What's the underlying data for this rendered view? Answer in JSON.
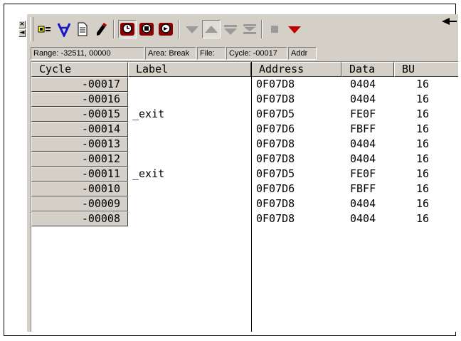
{
  "window": {
    "side_buttons": [
      "×",
      "◄"
    ]
  },
  "toolbar": {
    "buttons": [
      {
        "name": "status-icon",
        "glyph": "■≡"
      },
      {
        "name": "filter-icon",
        "glyph": "∀"
      },
      {
        "name": "document-icon",
        "glyph": "🗎"
      },
      {
        "name": "edit-icon",
        "glyph": "✎"
      },
      {
        "name": "trace-start-icon",
        "glyph": "◙"
      },
      {
        "name": "trace-stop-icon",
        "glyph": "◙"
      },
      {
        "name": "trace-restart-icon",
        "glyph": "◙"
      },
      {
        "name": "jump-down-icon",
        "glyph": "▼"
      },
      {
        "name": "jump-up-icon",
        "glyph": "▲"
      },
      {
        "name": "scroll-down-icon",
        "glyph": "▽"
      },
      {
        "name": "scroll-end-icon",
        "glyph": "⧗"
      },
      {
        "name": "stop-icon",
        "glyph": "■"
      },
      {
        "name": "down-red-icon",
        "glyph": "▼"
      }
    ],
    "colors": {
      "accent_blue": "#1515c8",
      "accent_red": "#c00000",
      "disabled": "#9a9a9a"
    }
  },
  "info_bar": {
    "range": "Range: -32511, 00000",
    "area": "Area: Break",
    "file": "File:",
    "cycle": "Cycle: -00017",
    "address": "Addr"
  },
  "table": {
    "headers": [
      "Cycle",
      "Label",
      "Address",
      "Data",
      "BU"
    ],
    "rows": [
      {
        "cycle": "-00017",
        "label": "",
        "address": "0F07D8",
        "data": "0404",
        "bus": "16"
      },
      {
        "cycle": "-00016",
        "label": "",
        "address": "0F07D8",
        "data": "0404",
        "bus": "16"
      },
      {
        "cycle": "-00015",
        "label": "_exit",
        "address": "0F07D5",
        "data": "FE0F",
        "bus": "16"
      },
      {
        "cycle": "-00014",
        "label": "",
        "address": "0F07D6",
        "data": "FBFF",
        "bus": "16"
      },
      {
        "cycle": "-00013",
        "label": "",
        "address": "0F07D8",
        "data": "0404",
        "bus": "16"
      },
      {
        "cycle": "-00012",
        "label": "",
        "address": "0F07D8",
        "data": "0404",
        "bus": "16"
      },
      {
        "cycle": "-00011",
        "label": "_exit",
        "address": "0F07D5",
        "data": "FE0F",
        "bus": "16"
      },
      {
        "cycle": "-00010",
        "label": "",
        "address": "0F07D6",
        "data": "FBFF",
        "bus": "16"
      },
      {
        "cycle": "-00009",
        "label": "",
        "address": "0F07D8",
        "data": "0404",
        "bus": "16"
      },
      {
        "cycle": "-00008",
        "label": "",
        "address": "0F07D8",
        "data": "0404",
        "bus": "16"
      }
    ]
  }
}
